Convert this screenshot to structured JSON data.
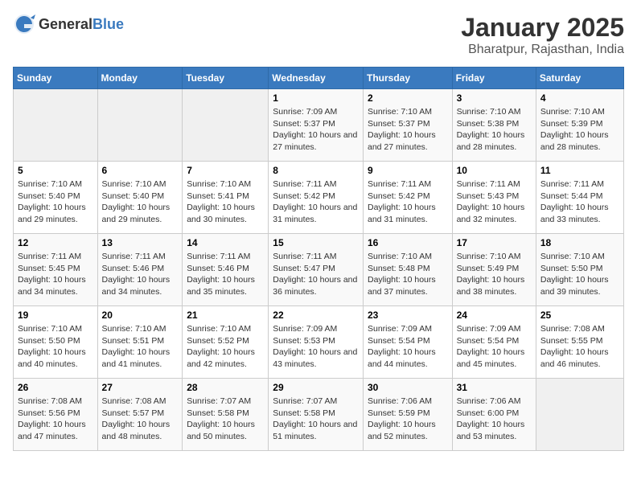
{
  "header": {
    "logo_general": "General",
    "logo_blue": "Blue",
    "title": "January 2025",
    "subtitle": "Bharatpur, Rajasthan, India"
  },
  "days_of_week": [
    "Sunday",
    "Monday",
    "Tuesday",
    "Wednesday",
    "Thursday",
    "Friday",
    "Saturday"
  ],
  "weeks": [
    [
      {
        "day": "",
        "sunrise": "",
        "sunset": "",
        "daylight": ""
      },
      {
        "day": "",
        "sunrise": "",
        "sunset": "",
        "daylight": ""
      },
      {
        "day": "",
        "sunrise": "",
        "sunset": "",
        "daylight": ""
      },
      {
        "day": "1",
        "sunrise": "Sunrise: 7:09 AM",
        "sunset": "Sunset: 5:37 PM",
        "daylight": "Daylight: 10 hours and 27 minutes."
      },
      {
        "day": "2",
        "sunrise": "Sunrise: 7:10 AM",
        "sunset": "Sunset: 5:37 PM",
        "daylight": "Daylight: 10 hours and 27 minutes."
      },
      {
        "day": "3",
        "sunrise": "Sunrise: 7:10 AM",
        "sunset": "Sunset: 5:38 PM",
        "daylight": "Daylight: 10 hours and 28 minutes."
      },
      {
        "day": "4",
        "sunrise": "Sunrise: 7:10 AM",
        "sunset": "Sunset: 5:39 PM",
        "daylight": "Daylight: 10 hours and 28 minutes."
      }
    ],
    [
      {
        "day": "5",
        "sunrise": "Sunrise: 7:10 AM",
        "sunset": "Sunset: 5:40 PM",
        "daylight": "Daylight: 10 hours and 29 minutes."
      },
      {
        "day": "6",
        "sunrise": "Sunrise: 7:10 AM",
        "sunset": "Sunset: 5:40 PM",
        "daylight": "Daylight: 10 hours and 29 minutes."
      },
      {
        "day": "7",
        "sunrise": "Sunrise: 7:10 AM",
        "sunset": "Sunset: 5:41 PM",
        "daylight": "Daylight: 10 hours and 30 minutes."
      },
      {
        "day": "8",
        "sunrise": "Sunrise: 7:11 AM",
        "sunset": "Sunset: 5:42 PM",
        "daylight": "Daylight: 10 hours and 31 minutes."
      },
      {
        "day": "9",
        "sunrise": "Sunrise: 7:11 AM",
        "sunset": "Sunset: 5:42 PM",
        "daylight": "Daylight: 10 hours and 31 minutes."
      },
      {
        "day": "10",
        "sunrise": "Sunrise: 7:11 AM",
        "sunset": "Sunset: 5:43 PM",
        "daylight": "Daylight: 10 hours and 32 minutes."
      },
      {
        "day": "11",
        "sunrise": "Sunrise: 7:11 AM",
        "sunset": "Sunset: 5:44 PM",
        "daylight": "Daylight: 10 hours and 33 minutes."
      }
    ],
    [
      {
        "day": "12",
        "sunrise": "Sunrise: 7:11 AM",
        "sunset": "Sunset: 5:45 PM",
        "daylight": "Daylight: 10 hours and 34 minutes."
      },
      {
        "day": "13",
        "sunrise": "Sunrise: 7:11 AM",
        "sunset": "Sunset: 5:46 PM",
        "daylight": "Daylight: 10 hours and 34 minutes."
      },
      {
        "day": "14",
        "sunrise": "Sunrise: 7:11 AM",
        "sunset": "Sunset: 5:46 PM",
        "daylight": "Daylight: 10 hours and 35 minutes."
      },
      {
        "day": "15",
        "sunrise": "Sunrise: 7:11 AM",
        "sunset": "Sunset: 5:47 PM",
        "daylight": "Daylight: 10 hours and 36 minutes."
      },
      {
        "day": "16",
        "sunrise": "Sunrise: 7:10 AM",
        "sunset": "Sunset: 5:48 PM",
        "daylight": "Daylight: 10 hours and 37 minutes."
      },
      {
        "day": "17",
        "sunrise": "Sunrise: 7:10 AM",
        "sunset": "Sunset: 5:49 PM",
        "daylight": "Daylight: 10 hours and 38 minutes."
      },
      {
        "day": "18",
        "sunrise": "Sunrise: 7:10 AM",
        "sunset": "Sunset: 5:50 PM",
        "daylight": "Daylight: 10 hours and 39 minutes."
      }
    ],
    [
      {
        "day": "19",
        "sunrise": "Sunrise: 7:10 AM",
        "sunset": "Sunset: 5:50 PM",
        "daylight": "Daylight: 10 hours and 40 minutes."
      },
      {
        "day": "20",
        "sunrise": "Sunrise: 7:10 AM",
        "sunset": "Sunset: 5:51 PM",
        "daylight": "Daylight: 10 hours and 41 minutes."
      },
      {
        "day": "21",
        "sunrise": "Sunrise: 7:10 AM",
        "sunset": "Sunset: 5:52 PM",
        "daylight": "Daylight: 10 hours and 42 minutes."
      },
      {
        "day": "22",
        "sunrise": "Sunrise: 7:09 AM",
        "sunset": "Sunset: 5:53 PM",
        "daylight": "Daylight: 10 hours and 43 minutes."
      },
      {
        "day": "23",
        "sunrise": "Sunrise: 7:09 AM",
        "sunset": "Sunset: 5:54 PM",
        "daylight": "Daylight: 10 hours and 44 minutes."
      },
      {
        "day": "24",
        "sunrise": "Sunrise: 7:09 AM",
        "sunset": "Sunset: 5:54 PM",
        "daylight": "Daylight: 10 hours and 45 minutes."
      },
      {
        "day": "25",
        "sunrise": "Sunrise: 7:08 AM",
        "sunset": "Sunset: 5:55 PM",
        "daylight": "Daylight: 10 hours and 46 minutes."
      }
    ],
    [
      {
        "day": "26",
        "sunrise": "Sunrise: 7:08 AM",
        "sunset": "Sunset: 5:56 PM",
        "daylight": "Daylight: 10 hours and 47 minutes."
      },
      {
        "day": "27",
        "sunrise": "Sunrise: 7:08 AM",
        "sunset": "Sunset: 5:57 PM",
        "daylight": "Daylight: 10 hours and 48 minutes."
      },
      {
        "day": "28",
        "sunrise": "Sunrise: 7:07 AM",
        "sunset": "Sunset: 5:58 PM",
        "daylight": "Daylight: 10 hours and 50 minutes."
      },
      {
        "day": "29",
        "sunrise": "Sunrise: 7:07 AM",
        "sunset": "Sunset: 5:58 PM",
        "daylight": "Daylight: 10 hours and 51 minutes."
      },
      {
        "day": "30",
        "sunrise": "Sunrise: 7:06 AM",
        "sunset": "Sunset: 5:59 PM",
        "daylight": "Daylight: 10 hours and 52 minutes."
      },
      {
        "day": "31",
        "sunrise": "Sunrise: 7:06 AM",
        "sunset": "Sunset: 6:00 PM",
        "daylight": "Daylight: 10 hours and 53 minutes."
      },
      {
        "day": "",
        "sunrise": "",
        "sunset": "",
        "daylight": ""
      }
    ]
  ]
}
